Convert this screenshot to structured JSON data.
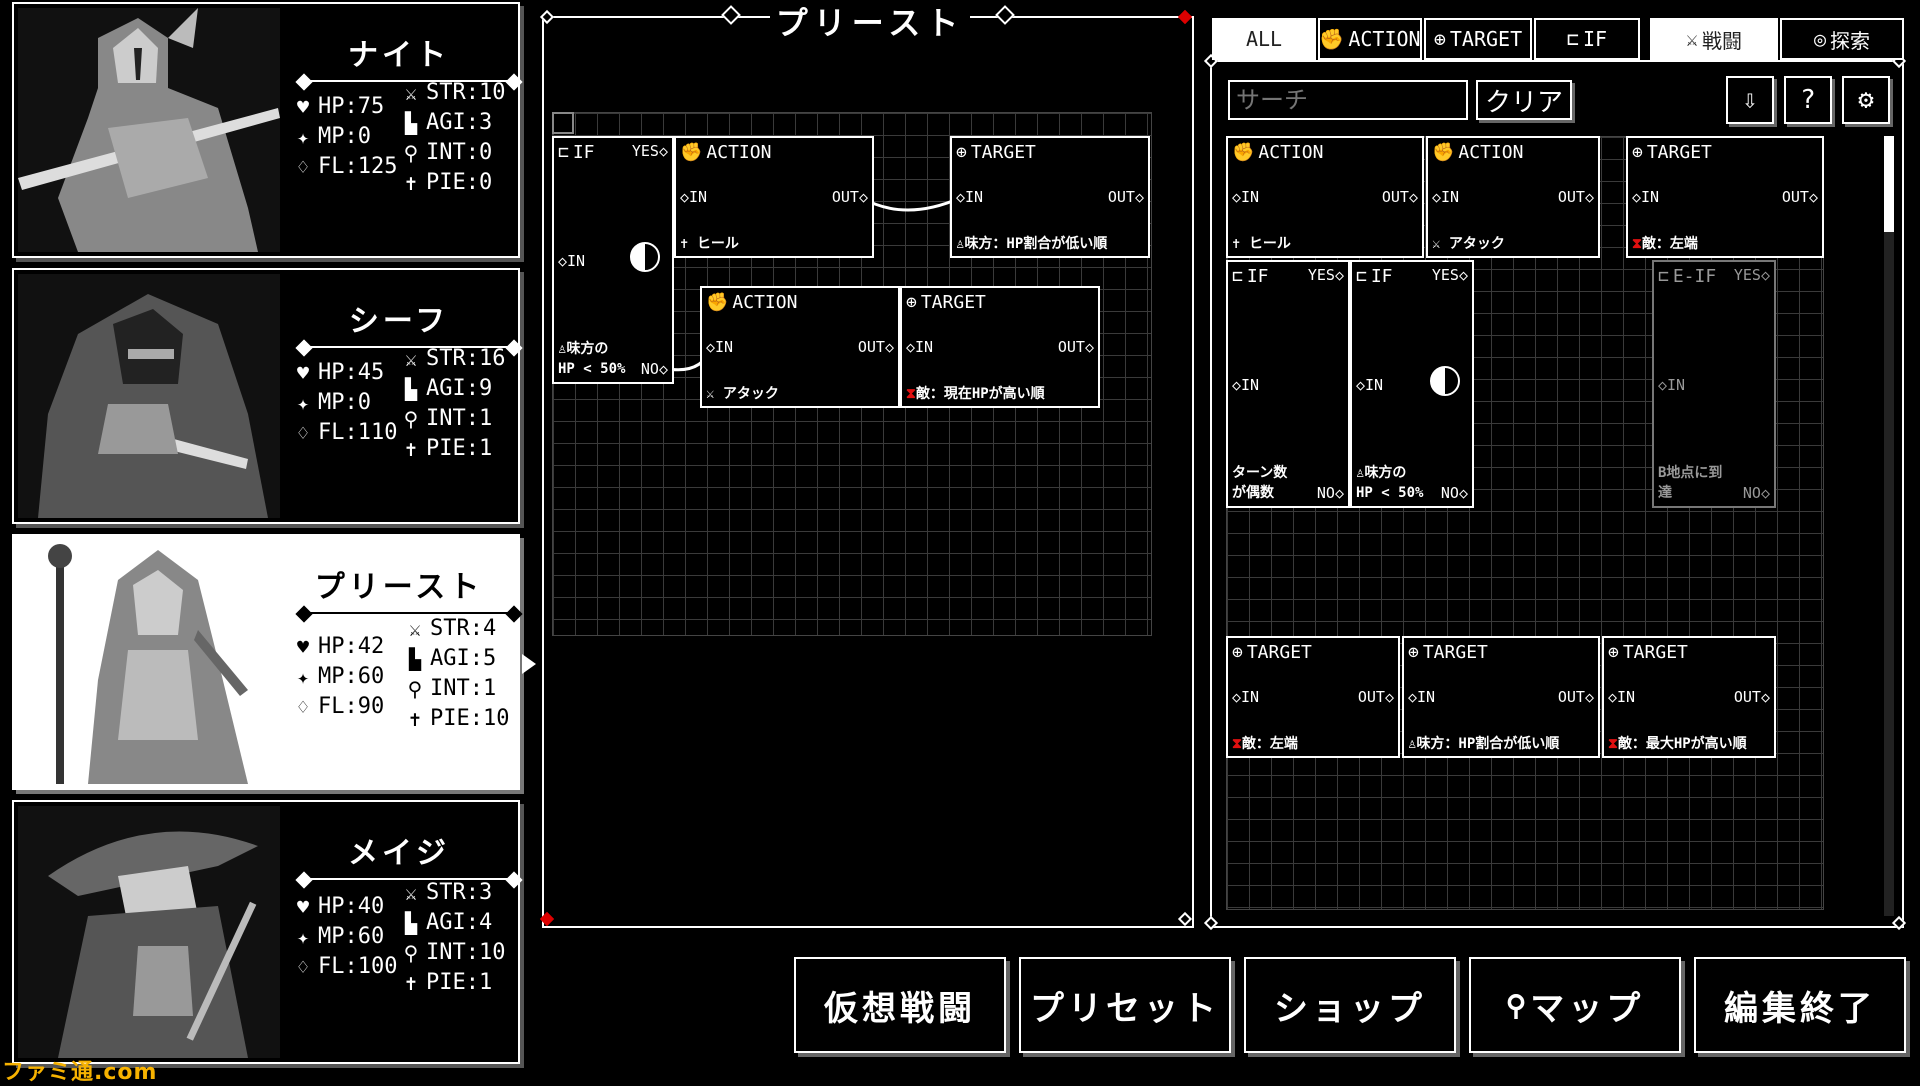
{
  "characters": [
    {
      "name": "ナイト",
      "hp": "HP:75",
      "mp": "MP:0",
      "fl": "FL:125",
      "str": "STR:10",
      "agi": "AGI:3",
      "int": "INT:0",
      "pie": "PIE:0"
    },
    {
      "name": "シーフ",
      "hp": "HP:45",
      "mp": "MP:0",
      "fl": "FL:110",
      "str": "STR:16",
      "agi": "AGI:9",
      "int": "INT:1",
      "pie": "PIE:1"
    },
    {
      "name": "プリースト",
      "hp": "HP:42",
      "mp": "MP:60",
      "fl": "FL:90",
      "str": "STR:4",
      "agi": "AGI:5",
      "int": "INT:1",
      "pie": "PIE:10"
    },
    {
      "name": "メイジ",
      "hp": "HP:40",
      "mp": "MP:60",
      "fl": "FL:100",
      "str": "STR:3",
      "agi": "AGI:4",
      "int": "INT:10",
      "pie": "PIE:1"
    }
  ],
  "selected_character": 2,
  "editor": {
    "title": "プリースト",
    "nodes": {
      "if1": {
        "type": "IF",
        "yes": "YES",
        "in": "IN",
        "no": "NO",
        "cond1": "味方の",
        "cond2": "HP < 50%"
      },
      "action1": {
        "type": "ACTION",
        "in": "IN",
        "out": "OUT",
        "caption": "ヒール"
      },
      "target1": {
        "type": "TARGET",
        "in": "IN",
        "out": "OUT",
        "caption": "味方：HP割合が低い順"
      },
      "action2": {
        "type": "ACTION",
        "in": "IN",
        "out": "OUT",
        "caption": "アタック"
      },
      "target2": {
        "type": "TARGET",
        "in": "IN",
        "out": "OUT",
        "caption": "敵：現在HPが高い順"
      }
    }
  },
  "tabs": [
    {
      "label": "ALL",
      "icon": ""
    },
    {
      "label": "ACTION",
      "icon": "✊"
    },
    {
      "label": "TARGET",
      "icon": "⊕"
    },
    {
      "label": "IF",
      "icon": "⊏"
    },
    {
      "label": "戦闘",
      "icon": "⚔"
    },
    {
      "label": "探索",
      "icon": "◎"
    }
  ],
  "search": {
    "placeholder": "サーチ",
    "clear_label": "クリア"
  },
  "palette": {
    "action_heal": {
      "type": "ACTION",
      "in": "IN",
      "out": "OUT",
      "caption": "ヒール"
    },
    "action_attack": {
      "type": "ACTION",
      "in": "IN",
      "out": "OUT",
      "caption": "アタック"
    },
    "target_left": {
      "type": "TARGET",
      "in": "IN",
      "out": "OUT",
      "caption": "敵：左端"
    },
    "if_turn": {
      "type": "IF",
      "yes": "YES",
      "in": "IN",
      "no": "NO",
      "cond1": "ターン数",
      "cond2": "が偶数"
    },
    "if_hp": {
      "type": "IF",
      "yes": "YES",
      "in": "IN",
      "no": "NO",
      "cond1": "味方の",
      "cond2": "HP < 50%"
    },
    "eif": {
      "type": "E-IF",
      "yes": "YES",
      "in": "IN",
      "no": "NO",
      "cond1": "B地点に到",
      "cond2": "達"
    },
    "target_left2": {
      "type": "TARGET",
      "in": "IN",
      "out": "OUT",
      "caption": "敵：左端"
    },
    "target_ally_hp": {
      "type": "TARGET",
      "in": "IN",
      "out": "OUT",
      "caption": "味方：HP割合が低い順"
    },
    "target_maxhp": {
      "type": "TARGET",
      "in": "IN",
      "out": "OUT",
      "caption": "敵：最大HPが高い順"
    }
  },
  "bottom_buttons": [
    "仮想戦闘",
    "プリセット",
    "ショップ",
    "マップ",
    "編集終了"
  ],
  "watermark": "ファミ通.com",
  "colors": {
    "accent_red": "#e01010",
    "text": "#ffffff",
    "background": "#000000"
  }
}
